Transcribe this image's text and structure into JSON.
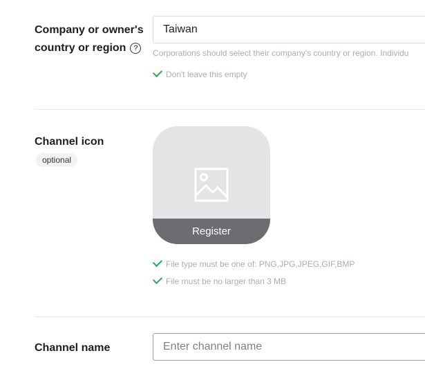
{
  "country_field": {
    "label": "Company or owner's country or region",
    "help_icon": "help-question-icon",
    "value": "Taiwan",
    "hint": "Corporations should select their company's country or region. Individu",
    "validation": "Don't leave this empty"
  },
  "channel_icon": {
    "label": "Channel icon",
    "badge": "optional",
    "placeholder_icon": "image-icon",
    "register_label": "Register",
    "rules": [
      "File type must be one of: PNG,JPG,JPEG,GIF,BMP",
      "File must be no larger than 3 MB"
    ]
  },
  "channel_name": {
    "label": "Channel name",
    "placeholder": "Enter channel name"
  },
  "colors": {
    "check": "#19b34b",
    "register_bar": "#6b6d70",
    "uploader_bg": "#e3e4e6"
  }
}
